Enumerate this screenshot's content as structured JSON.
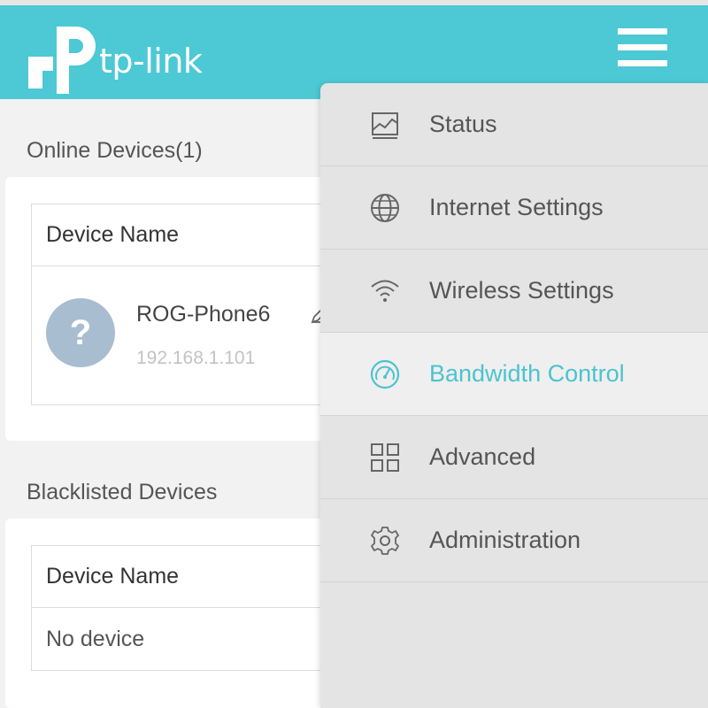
{
  "header": {
    "brand": "tp-link",
    "brand_color": "#4cc9d4"
  },
  "online": {
    "title": "Online Devices(1)",
    "column_header": "Device Name",
    "devices": [
      {
        "name": "ROG-Phone6",
        "ip": "192.168.1.101",
        "avatar_glyph": "?"
      }
    ]
  },
  "blacklist": {
    "title": "Blacklisted Devices",
    "column_header": "Device Name",
    "empty_text": "No device"
  },
  "menu": {
    "active_color": "#4cc3cf",
    "items": [
      {
        "label": "Status",
        "icon": "status-chart-icon",
        "active": false
      },
      {
        "label": "Internet Settings",
        "icon": "globe-icon",
        "active": false
      },
      {
        "label": "Wireless Settings",
        "icon": "wifi-icon",
        "active": false
      },
      {
        "label": "Bandwidth Control",
        "icon": "speedometer-icon",
        "active": true
      },
      {
        "label": "Advanced",
        "icon": "grid-icon",
        "active": false
      },
      {
        "label": "Administration",
        "icon": "gear-icon",
        "active": false
      }
    ]
  }
}
